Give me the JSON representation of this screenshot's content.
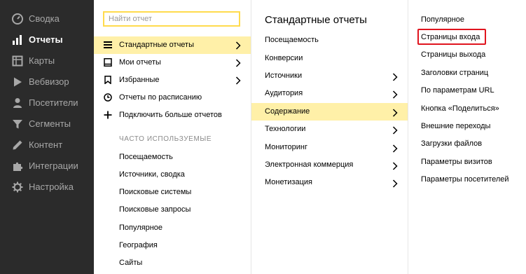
{
  "sidebar": {
    "items": [
      {
        "label": "Сводка",
        "icon": "dashboard-icon"
      },
      {
        "label": "Отчеты",
        "icon": "bar-chart-icon",
        "active": true
      },
      {
        "label": "Карты",
        "icon": "map-grid-icon"
      },
      {
        "label": "Вебвизор",
        "icon": "play-icon"
      },
      {
        "label": "Посетители",
        "icon": "person-icon"
      },
      {
        "label": "Сегменты",
        "icon": "filter-funnel-icon"
      },
      {
        "label": "Контент",
        "icon": "pencil-icon"
      },
      {
        "label": "Интеграции",
        "icon": "puzzle-icon"
      },
      {
        "label": "Настройка",
        "icon": "gear-icon"
      }
    ]
  },
  "column1": {
    "search_placeholder": "Найти отчет",
    "menu": [
      {
        "label": "Стандартные отчеты",
        "icon": "list-icon",
        "has_arrow": true,
        "highlighted": true
      },
      {
        "label": "Мои отчеты",
        "icon": "book-icon",
        "has_arrow": true
      },
      {
        "label": "Избранные",
        "icon": "bookmark-icon",
        "has_arrow": true
      },
      {
        "label": "Отчеты по расписанию",
        "icon": "clock-icon",
        "has_arrow": false
      },
      {
        "label": "Подключить больше отчетов",
        "icon": "plus-icon",
        "has_arrow": false
      }
    ],
    "frequent_title": "ЧАСТО ИСПОЛЬЗУЕМЫЕ",
    "frequent": [
      "Посещаемость",
      "Источники, сводка",
      "Поисковые системы",
      "Поисковые запросы",
      "Популярное",
      "География",
      "Сайты"
    ]
  },
  "column2": {
    "title": "Стандартные отчеты",
    "items": [
      {
        "label": "Посещаемость",
        "has_arrow": false
      },
      {
        "label": "Конверсии",
        "has_arrow": false
      },
      {
        "label": "Источники",
        "has_arrow": true
      },
      {
        "label": "Аудитория",
        "has_arrow": true
      },
      {
        "label": "Содержание",
        "has_arrow": true,
        "highlighted": true
      },
      {
        "label": "Технологии",
        "has_arrow": true
      },
      {
        "label": "Мониторинг",
        "has_arrow": true
      },
      {
        "label": "Электронная коммерция",
        "has_arrow": true
      },
      {
        "label": "Монетизация",
        "has_arrow": true
      }
    ]
  },
  "column3": {
    "items": [
      "Популярное",
      "Страницы входа",
      "Страницы выхода",
      "Заголовки страниц",
      "По параметрам URL",
      "Кнопка «Поделиться»",
      "Внешние переходы",
      "Загрузки файлов",
      "Параметры визитов",
      "Параметры посетителей"
    ],
    "boxed_item": "Страницы входа"
  },
  "colors": {
    "sidebar_bg": "#2b2b2b",
    "highlight": "#fff0a8",
    "search_border": "#ffdb4d",
    "annotation_box": "#e0141e"
  }
}
